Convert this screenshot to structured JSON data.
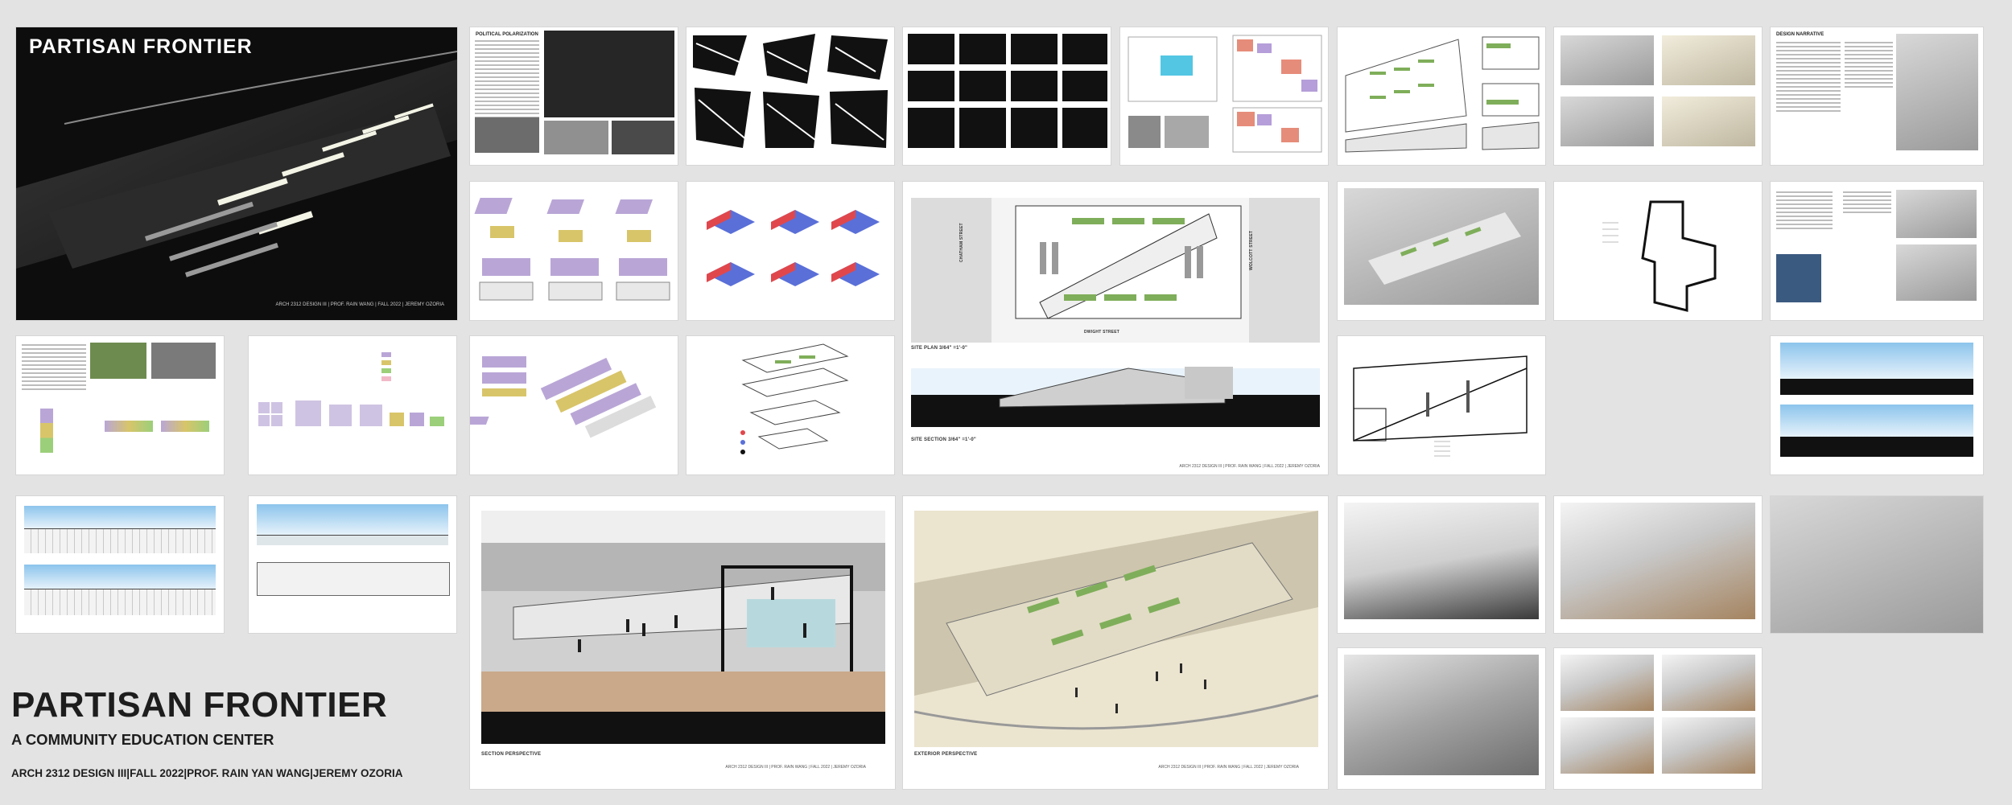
{
  "cover": {
    "title": "PARTISAN FRONTIER",
    "credit": "ARCH 2312 DESIGN III | PROF. RAIN WANG | FALL 2022 | JEREMY OZORIA"
  },
  "board": {
    "title": "PARTISAN FRONTIER",
    "subtitle": "A COMMUNITY EDUCATION CENTER",
    "credit": "ARCH 2312 DESIGN III|FALL 2022|PROF. RAIN YAN WANG|JEREMY OZORIA"
  },
  "sheets": {
    "political": {
      "heading": "POLITICAL POLARIZATION"
    },
    "narrative": {
      "heading": "DESIGN NARRATIVE"
    },
    "siteplan": {
      "plan_label": "SITE PLAN 3/64\" =1'-0\"",
      "section_label": "SITE SECTION 3/64\" =1'-0\"",
      "street_bottom": "DWIGHT STREET",
      "street_left": "CHATHAM STREET",
      "street_right": "WOLCOTT STREET",
      "credit": "ARCH 2312 DESIGN III | PROF. RAIN WANG | FALL 2022 | JEREMY OZORIA"
    },
    "section_perspective": {
      "label": "SECTION PERSPECTIVE",
      "credit": "ARCH 2312 DESIGN III | PROF. RAIN WANG | FALL 2022 | JEREMY OZORIA"
    },
    "exterior_perspective": {
      "label": "EXTERIOR PERSPECTIVE",
      "credit": "ARCH 2312 DESIGN III | PROF. RAIN WANG | FALL 2022 | JEREMY OZORIA"
    }
  },
  "colors": {
    "background": "#e3e3e3",
    "title_text": "#1d1d1d",
    "cover_dark": "#0d0d0d",
    "program_purple": "#b9a6d6",
    "program_red": "#e0474c",
    "program_blue": "#5a6fd8",
    "green_roof": "#7fae5a",
    "sky_blue": "#8cc4ec"
  }
}
